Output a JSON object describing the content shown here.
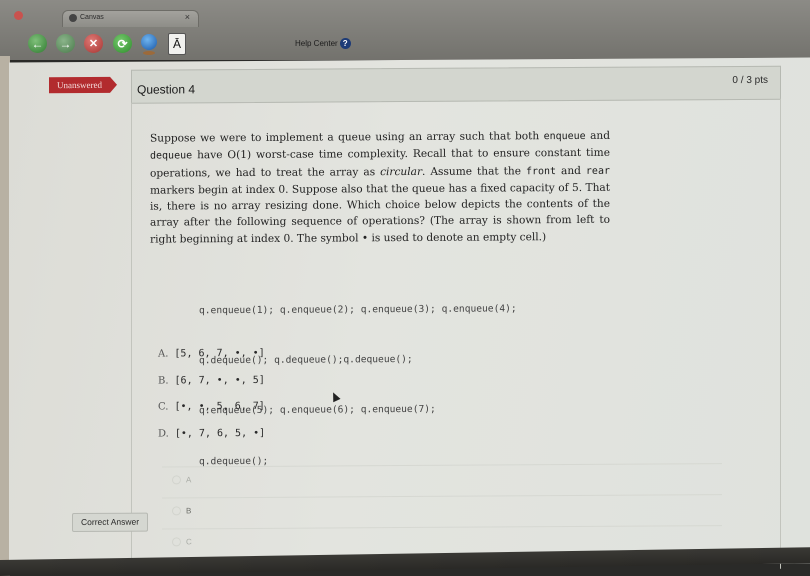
{
  "browser": {
    "tab_title": "Canvas",
    "tab_close": "×",
    "toolbar": {
      "back_icon": "←",
      "forward_icon": "→",
      "stop_icon": "✕",
      "reload_icon": "⟳",
      "font_icon": "Ā"
    },
    "help_center_label": "Help Center",
    "help_icon": "?"
  },
  "question": {
    "status_badge": "Unanswered",
    "title": "Question 4",
    "points": "0 / 3 pts",
    "prompt": {
      "p1": "Suppose we were to implement a queue using an array such that both ",
      "c1": "enqueue",
      "p2": " and ",
      "c2": "dequeue",
      "p3": " have O(1) worst-case time complexity. Recall that to ensure constant time operations, we had to treat the array as ",
      "i1": "circular",
      "p4": ". Assume that the ",
      "c3": "front",
      "p5": " and ",
      "c4": "rear",
      "p6": " markers begin at index 0. Suppose also that the queue has a fixed capacity of 5. That is, there is no array resizing done. Which choice below depicts the contents of the array after the following sequence of operations? (The array is shown from left to right beginning at index 0. The symbol • is used to denote an empty cell.)"
    },
    "code_lines": [
      "q.enqueue(1); q.enqueue(2); q.enqueue(3); q.enqueue(4);",
      "q.dequeue(); q.dequeue();q.dequeue();",
      "q.enqueue(5); q.enqueue(6); q.enqueue(7);",
      "q.dequeue();"
    ],
    "choices": [
      {
        "letter": "A.",
        "text": "[5, 6, 7, •, •]"
      },
      {
        "letter": "B.",
        "text": "[6, 7, •, •, 5]"
      },
      {
        "letter": "C.",
        "text": "[•, •, 5, 6, 7]"
      },
      {
        "letter": "D.",
        "text": "[•, 7, 6, 5, •]"
      }
    ],
    "answer_options": [
      "A",
      "B",
      "C"
    ],
    "correct_answer_label": "Correct Answer"
  }
}
